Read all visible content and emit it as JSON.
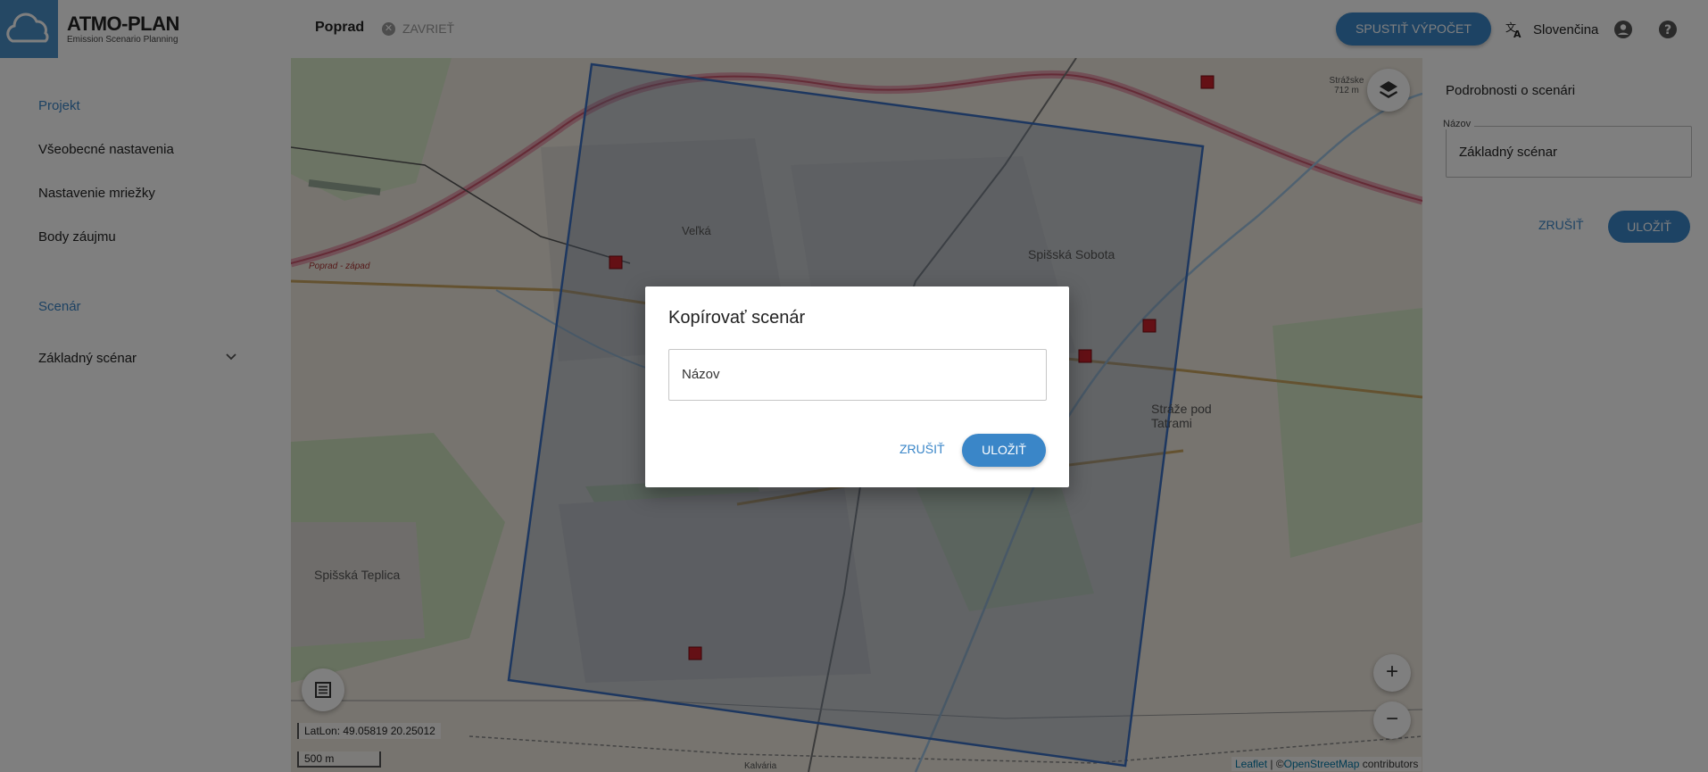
{
  "app": {
    "title": "ATMO-PLAN",
    "subtitle": "Emission Scenario Planning",
    "colors": {
      "accent": "#3a86c8",
      "logo_bg": "#4a90c9"
    }
  },
  "sidebar": {
    "project_section": "Projekt",
    "project_items": [
      {
        "label": "Všeobecné nastavenia"
      },
      {
        "label": "Nastavenie mriežky"
      },
      {
        "label": "Body záujmu"
      }
    ],
    "scenario_section": "Scenár",
    "scenario_items": [
      {
        "label": "Základný scénar",
        "icon": "chevron-down-icon"
      }
    ]
  },
  "topbar": {
    "project_name": "Poprad",
    "close_label": "ZAVRIEŤ",
    "run_button": "SPUSTIŤ VÝPOČET",
    "language": "Slovenčina",
    "language_icon": "translate-icon",
    "account_icon": "account-icon",
    "help_icon": "help-icon"
  },
  "right_panel": {
    "title": "Podrobnosti o scenári",
    "field_label": "Názov",
    "field_value": "Základný scénar",
    "cancel": "ZRUŠIŤ",
    "save": "ULOŽIŤ"
  },
  "map": {
    "latlon_text": "LatLon: 49.05819 20.25012",
    "scale_text": "500 m",
    "attribution_leaflet": "Leaflet",
    "attribution_sep": " | ©",
    "attribution_osm": "OpenStreetMap",
    "attribution_tail": " contributors",
    "labels": [
      "Spišská Sobota",
      "Spišská Teplica",
      "Stráže pod Tatrami",
      "Veľká",
      "Poprad - západ",
      "Kalvária",
      "Strážske 712 m"
    ],
    "zoom_in": "+",
    "zoom_out": "−",
    "layers_icon": "layers-icon",
    "list_icon": "list-icon"
  },
  "dialog": {
    "title": "Kopírovať scenár",
    "input_placeholder": "Názov",
    "cancel": "ZRUŠIŤ",
    "save": "ULOŽIŤ"
  }
}
